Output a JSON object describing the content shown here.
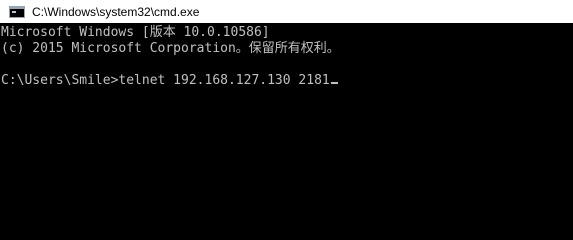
{
  "window": {
    "title": "C:\\Windows\\system32\\cmd.exe",
    "icon": "console-icon"
  },
  "console": {
    "lines": [
      "Microsoft Windows [版本 10.0.10586]",
      "(c) 2015 Microsoft Corporation。保留所有权利。",
      "",
      "C:\\Users\\Smile>telnet 192.168.127.130 2181"
    ]
  },
  "colors": {
    "background": "#000000",
    "text": "#c0c0c0",
    "titlebar": "#ffffff"
  }
}
